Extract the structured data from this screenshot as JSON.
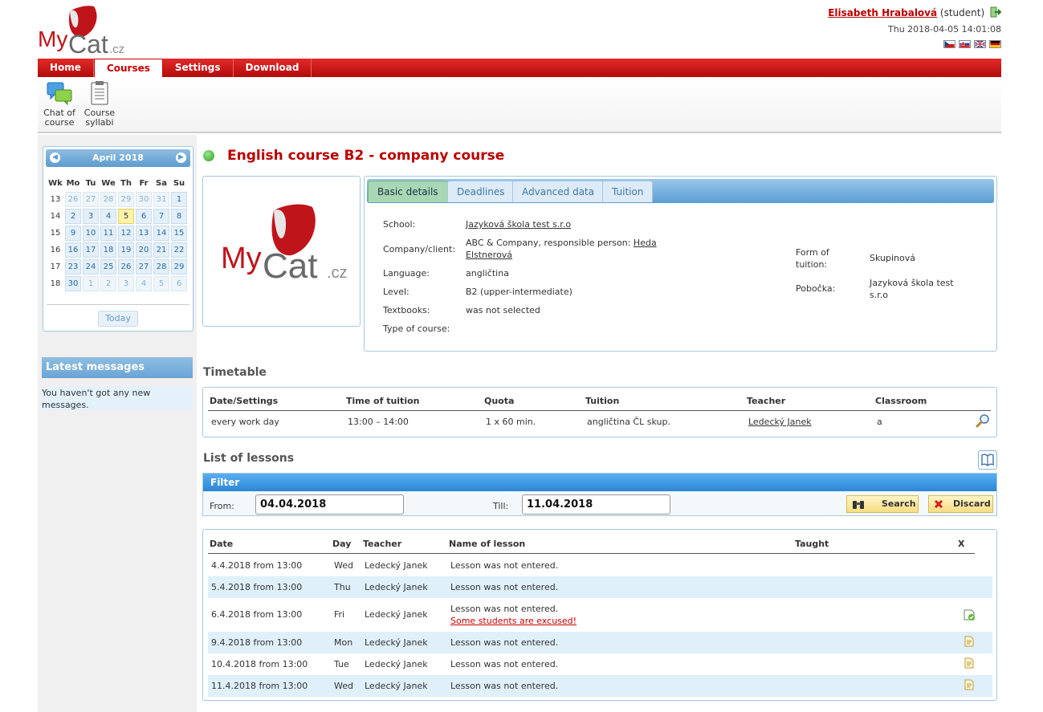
{
  "brand": {
    "logo_text": "MyCat.cz"
  },
  "user": {
    "name": "Elisabeth Hrabalová",
    "role": "(student)",
    "datetime": "Thu 2018-04-05 14:01:08"
  },
  "languages": [
    "cs",
    "sk",
    "en",
    "de"
  ],
  "nav": {
    "tabs": [
      "Home",
      "Courses",
      "Settings",
      "Download"
    ],
    "active": "Courses"
  },
  "toolbar": {
    "chat_line1": "Chat of",
    "chat_line2": "course",
    "syllabi_line1": "Course",
    "syllabi_line2": "syllabi"
  },
  "calendar": {
    "month": "April 2018",
    "headers": [
      "Wk",
      "Mo",
      "Tu",
      "We",
      "Th",
      "Fr",
      "Sa",
      "Su"
    ],
    "weeks": [
      {
        "wk": "13",
        "days": [
          "26",
          "27",
          "28",
          "29",
          "30",
          "31",
          "1"
        ]
      },
      {
        "wk": "14",
        "days": [
          "2",
          "3",
          "4",
          "5",
          "6",
          "7",
          "8"
        ]
      },
      {
        "wk": "15",
        "days": [
          "9",
          "10",
          "11",
          "12",
          "13",
          "14",
          "15"
        ]
      },
      {
        "wk": "16",
        "days": [
          "16",
          "17",
          "18",
          "19",
          "20",
          "21",
          "22"
        ]
      },
      {
        "wk": "17",
        "days": [
          "23",
          "24",
          "25",
          "26",
          "27",
          "28",
          "29"
        ]
      },
      {
        "wk": "18",
        "days": [
          "30",
          "1",
          "2",
          "3",
          "4",
          "5",
          "6"
        ]
      }
    ],
    "today_label": "Today"
  },
  "messages": {
    "title": "Latest messages",
    "text": "You haven't got any new messages."
  },
  "course": {
    "title": "English course B2 - company course",
    "status_color": "#29a01e",
    "tabs": [
      "Basic details",
      "Deadlines",
      "Advanced data",
      "Tuition"
    ],
    "details": {
      "school_label": "School:",
      "school": "Jazyková škola test s.r.o",
      "company_label": "Company/client:",
      "company_prefix": "ABC & Company, responsible person: ",
      "company_person_1": "Heda",
      "company_person_2": "Elstnerová",
      "language_label": "Language:",
      "language": "angličtina",
      "level_label": "Level:",
      "level": "B2 (upper-intermediate)",
      "textbooks_label": "Textbooks:",
      "textbooks": "was not selected",
      "type_label": "Type of course:",
      "form_label_1": "Form of",
      "form_label_2": "tuition:",
      "form": "Skupinová",
      "branch_label": "Pobočka:",
      "branch_1": "Jazyková škola test",
      "branch_2": "s.r.o"
    }
  },
  "timetable": {
    "title": "Timetable",
    "headers": [
      "Date/Settings",
      "Time of tuition",
      "Quota",
      "Tuition",
      "Teacher",
      "Classroom"
    ],
    "row": [
      "every work day",
      "13:00 – 14:00",
      "1 x 60 min.",
      "angličtina ČL skup.",
      "Ledecký Janek",
      "a"
    ]
  },
  "lessons": {
    "title": "List of lessons",
    "filter": {
      "title": "Filter",
      "from_label": "From:",
      "from": "04.04.2018",
      "till_label": "Till:",
      "till": "11.04.2018",
      "search": "Search",
      "discard": "Discard"
    },
    "headers": [
      "Date",
      "Day",
      "Teacher",
      "Name of lesson",
      "Taught",
      "X"
    ],
    "rows": [
      {
        "date": "4.4.2018 from 13:00",
        "day": "Wed",
        "teacher": "Ledecký Janek",
        "name": "Lesson was not entered."
      },
      {
        "date": "5.4.2018 from 13:00",
        "day": "Thu",
        "teacher": "Ledecký Janek",
        "name": "Lesson was not entered."
      },
      {
        "date": "6.4.2018 from 13:00",
        "day": "Fri",
        "teacher": "Ledecký Janek",
        "name": "Lesson was not entered.",
        "note": "Some students are excused!"
      },
      {
        "date": "9.4.2018 from 13:00",
        "day": "Mon",
        "teacher": "Ledecký Janek",
        "name": "Lesson was not entered."
      },
      {
        "date": "10.4.2018 from 13:00",
        "day": "Tue",
        "teacher": "Ledecký Janek",
        "name": "Lesson was not entered."
      },
      {
        "date": "11.4.2018 from 13:00",
        "day": "Wed",
        "teacher": "Ledecký Janek",
        "name": "Lesson was not entered."
      }
    ]
  }
}
